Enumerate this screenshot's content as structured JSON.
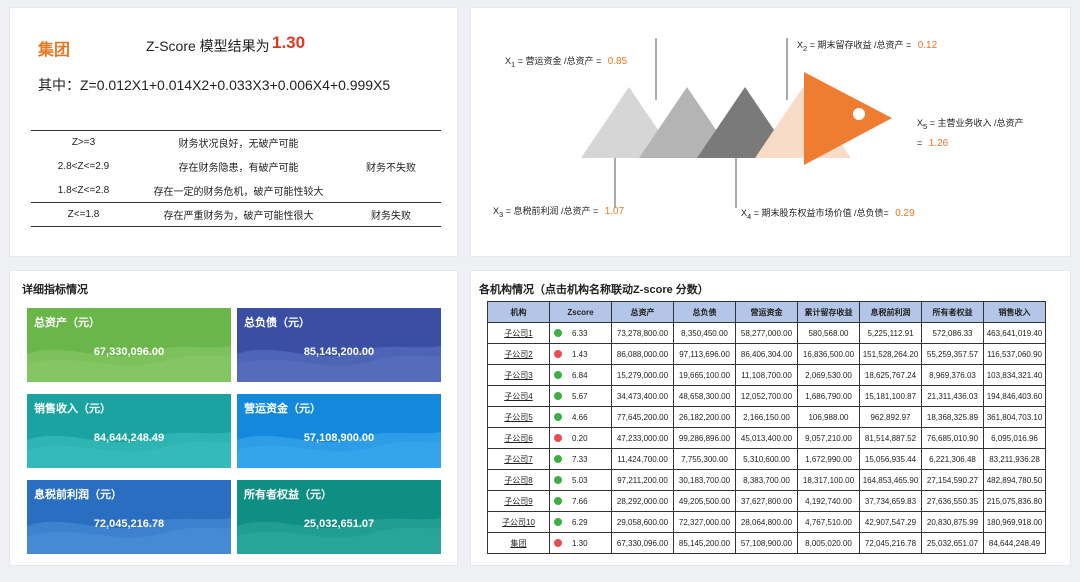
{
  "model": {
    "group_label": "集团",
    "title": "Z-Score 模型结果为",
    "result": "1.30",
    "formula": "其中：Z=0.012X1+0.014X2+0.033X3+0.006X4+0.999X5",
    "rules": [
      {
        "range": "Z>=3",
        "desc": "财务状况良好，无破产可能",
        "tag": ""
      },
      {
        "range": "2.8<Z<=2.9",
        "desc": "存在财务隐患，有破产可能",
        "tag": "财务不失败"
      },
      {
        "range": "1.8<Z<=2.8",
        "desc": "存在一定的财务危机，破产可能性较大",
        "tag": ""
      },
      {
        "range": "Z<=1.8",
        "desc": "存在严重财务为，破产可能性很大",
        "tag": "财务失败"
      }
    ]
  },
  "fishbone": {
    "x1": {
      "var": "X",
      "sub": "1",
      "label": " = 营运资金 /总资产 = ",
      "value": "0.85"
    },
    "x2": {
      "var": "X",
      "sub": "2",
      "label": " = 期末留存收益 /总资产 = ",
      "value": "0.12"
    },
    "x3": {
      "var": "X",
      "sub": "3",
      "label": " = 息税前利润 /总资产 = ",
      "value": "1.07"
    },
    "x4": {
      "var": "X",
      "sub": "4",
      "label": " = 期末股东权益市场价值 /总负债= ",
      "value": "0.29"
    },
    "x5": {
      "var": "X",
      "sub": "5",
      "label": " = 主营业务收入 /总资产",
      "label2": "= ",
      "value": "1.26"
    },
    "colors": [
      "#d6d6d6",
      "#b4b4b4",
      "#7a7a7a",
      "#f9dcc7",
      "#ee7d31"
    ]
  },
  "detail": {
    "title": "详细指标情况",
    "cards": [
      {
        "label": "总资产（元）",
        "value": "67,330,096.00",
        "color": "#6ab64a",
        "wave": "#8ccb6c"
      },
      {
        "label": "总负债（元）",
        "value": "85,145,200.00",
        "color": "#3a4fa3",
        "wave": "#5f76c6"
      },
      {
        "label": "销售收入（元）",
        "value": "84,644,248.49",
        "color": "#1aa3a0",
        "wave": "#3fc2c2"
      },
      {
        "label": "营运资金（元）",
        "value": "57,108,900.00",
        "color": "#1488dd",
        "wave": "#41aef0"
      },
      {
        "label": "息税前利润（元）",
        "value": "72,045,216.78",
        "color": "#2a6ec2",
        "wave": "#4f93da"
      },
      {
        "label": "所有者权益（元）",
        "value": "25,032,651.07",
        "color": "#0f8f84",
        "wave": "#32ab9f"
      }
    ]
  },
  "orgs": {
    "title": "各机构情况（点击机构名称联动Z-score 分数）",
    "headers": [
      "机构",
      "Zscore",
      "总资产",
      "总负债",
      "营运资金",
      "累计留存收益",
      "息税前利润",
      "所有者权益",
      "销售收入"
    ],
    "rows": [
      {
        "name": "子公司1",
        "status": "green",
        "z": "6.33",
        "v": [
          "73,278,800.00",
          "8,350,450.00",
          "58,277,000.00",
          "580,568.00",
          "5,225,112.91",
          "572,086.33",
          "463,641,019.40"
        ]
      },
      {
        "name": "子公司2",
        "status": "red",
        "z": "1.43",
        "v": [
          "86,088,000.00",
          "97,113,696.00",
          "86,406,304.00",
          "16,836,500.00",
          "151,528,264.20",
          "55,259,357.57",
          "116,537,060.90"
        ]
      },
      {
        "name": "子公司3",
        "status": "green",
        "z": "6.84",
        "v": [
          "15,279,000.00",
          "19,665,100.00",
          "11,108,700.00",
          "2,069,530.00",
          "18,625,767.24",
          "8,969,376.03",
          "103,834,321.40"
        ]
      },
      {
        "name": "子公司4",
        "status": "green",
        "z": "5.67",
        "v": [
          "34,473,400.00",
          "48,658,300.00",
          "12,052,700.00",
          "1,686,790.00",
          "15,181,100.87",
          "21,311,436.03",
          "194,846,403.60"
        ]
      },
      {
        "name": "子公司5",
        "status": "green",
        "z": "4.66",
        "v": [
          "77,645,200.00",
          "26,182,200.00",
          "2,166,150.00",
          "106,988.00",
          "962,892.97",
          "18,368,325.89",
          "361,804,703.10"
        ]
      },
      {
        "name": "子公司6",
        "status": "red",
        "z": "0.20",
        "v": [
          "47,233,000.00",
          "99,286,896.00",
          "45,013,400.00",
          "9,057,210.00",
          "81,514,887.52",
          "76,685,010.90",
          "6,095,016.96"
        ]
      },
      {
        "name": "子公司7",
        "status": "green",
        "z": "7.33",
        "v": [
          "11,424,700.00",
          "7,755,300.00",
          "5,310,600.00",
          "1,672,990.00",
          "15,056,935.44",
          "6,221,306.48",
          "83,211,936.28"
        ]
      },
      {
        "name": "子公司8",
        "status": "green",
        "z": "5.03",
        "v": [
          "97,211,200.00",
          "30,183,700.00",
          "8,383,700.00",
          "18,317,100.00",
          "164,853,465.90",
          "27,154,590.27",
          "482,894,780.50"
        ]
      },
      {
        "name": "子公司9",
        "status": "green",
        "z": "7.66",
        "v": [
          "28,292,000.00",
          "49,205,500.00",
          "37,627,800.00",
          "4,192,740.00",
          "37,734,659.83",
          "27,636,550.35",
          "215,075,836.80"
        ]
      },
      {
        "name": "子公司10",
        "status": "green",
        "z": "6.29",
        "v": [
          "29,058,600.00",
          "72,327,000.00",
          "28,064,800.00",
          "4,767,510.00",
          "42,907,547.29",
          "20,830,875.99",
          "180,969,918.00"
        ]
      },
      {
        "name": "集团",
        "status": "red",
        "z": "1.30",
        "v": [
          "67,330,096.00",
          "85,145,200.00",
          "57,108,900.00",
          "8,005,020.00",
          "72,045,216.78",
          "25,032,651.07",
          "84,644,248.49"
        ]
      }
    ],
    "status_colors": {
      "green": "#3cb043",
      "red": "#e84e4e"
    }
  }
}
